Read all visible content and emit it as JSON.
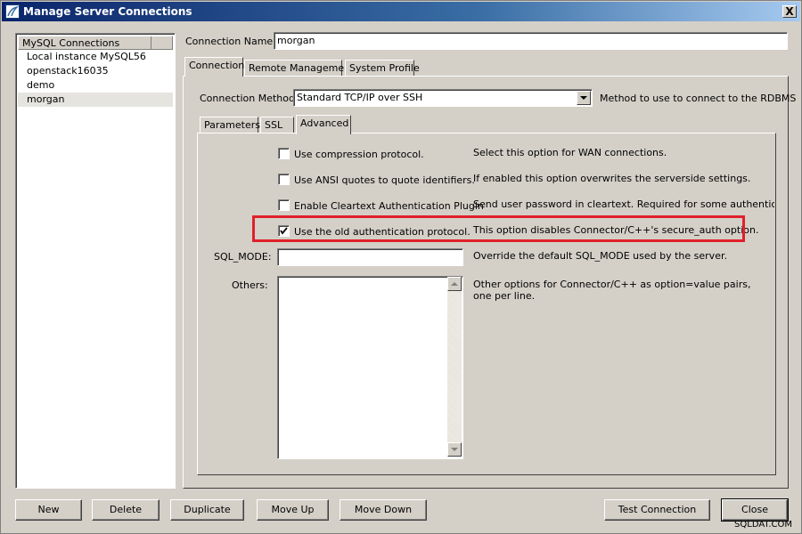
{
  "window": {
    "title": "Manage Server Connections",
    "close_glyph": "X"
  },
  "connections": {
    "header": "MySQL Connections",
    "items": [
      {
        "label": "Local instance MySQL56"
      },
      {
        "label": "openstack16035"
      },
      {
        "label": "demo"
      },
      {
        "label": "morgan"
      }
    ],
    "selected": "morgan"
  },
  "connection_name": {
    "label": "Connection Name:",
    "value": "morgan"
  },
  "main_tabs": [
    {
      "label": "Connection"
    },
    {
      "label": "Remote Management"
    },
    {
      "label": "System Profile"
    }
  ],
  "connection_method": {
    "label": "Connection Method:",
    "value": "Standard TCP/IP over SSH",
    "hint": "Method to use to connect to the RDBMS"
  },
  "sub_tabs": [
    {
      "label": "Parameters"
    },
    {
      "label": "SSL"
    },
    {
      "label": "Advanced"
    }
  ],
  "advanced": {
    "options": [
      {
        "label": "Use compression protocol.",
        "checked": false,
        "description": "Select this option for WAN connections."
      },
      {
        "label": "Use ANSI quotes to quote identifiers.",
        "checked": false,
        "description": "If enabled this option overwrites the serverside settings."
      },
      {
        "label": "Enable Cleartext Authentication Plugin",
        "checked": false,
        "description": "Send user password in cleartext. Required for some authentication me"
      },
      {
        "label": "Use the old authentication protocol.",
        "checked": true,
        "description": "This option disables Connector/C++'s secure_auth option."
      }
    ],
    "sql_mode": {
      "label": "SQL_MODE:",
      "value": "",
      "description": "Override the default SQL_MODE used by the server."
    },
    "others": {
      "label": "Others:",
      "value": "",
      "description_line1": "Other options for Connector/C++ as option=value pairs,",
      "description_line2": "one per line."
    }
  },
  "buttons": {
    "new": "New",
    "delete": "Delete",
    "duplicate": "Duplicate",
    "move_up": "Move Up",
    "move_down": "Move Down",
    "test_connection": "Test Connection",
    "close": "Close"
  },
  "watermark": "SQLDAT.COM",
  "colors": {
    "highlight": "#e0202a",
    "titlebar": "#0a246a"
  }
}
